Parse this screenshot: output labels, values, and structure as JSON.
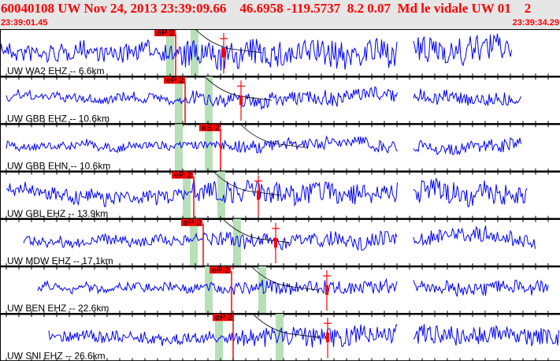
{
  "header": {
    "title": "60040108 UW Nov 24, 2013 23:39:09.66    46.6958 -119.5737  8.2 0.07  Md le vidale UW 01    2",
    "start_time": "23:39:01.45",
    "end_time": "23:39:34.29"
  },
  "colors": {
    "trace": "#0000ff",
    "pick": "#ff0000",
    "window": "#b8e0b8",
    "header_text": "#ff0000"
  },
  "channels": [
    {
      "label": "UW WA2 EHZ -- 6.6km",
      "pick": "eP 2"
    },
    {
      "label": "UW GBB EHZ -- 10.6km",
      "pick": "eP 2"
    },
    {
      "label": "UW GBB EHN -- 10.6km",
      "pick": "eS 2"
    },
    {
      "label": "UW GBL EHZ -- 13.9km",
      "pick": "eP 2"
    },
    {
      "label": "UW MDW EHZ -- 17.1km",
      "pick": "eP 2"
    },
    {
      "label": "UW BEN EHZ -- 22.6km",
      "pick": "eP 2"
    },
    {
      "label": "UW SNI EHZ -- 26.6km",
      "pick": "eP 2"
    }
  ]
}
